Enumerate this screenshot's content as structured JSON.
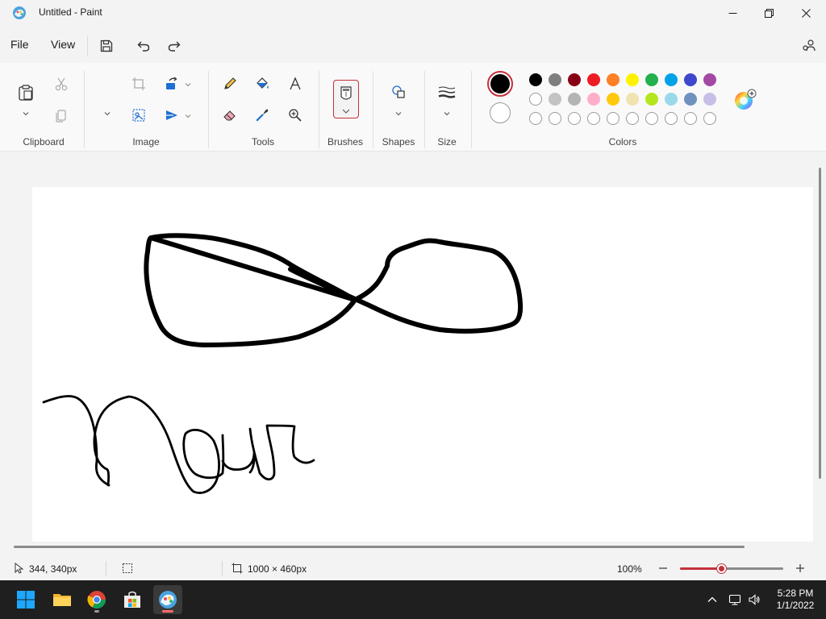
{
  "window": {
    "title": "Untitled - Paint"
  },
  "menu": {
    "file": "File",
    "view": "View"
  },
  "ribbon": {
    "groups": {
      "clipboard": "Clipboard",
      "image": "Image",
      "tools": "Tools",
      "brushes": "Brushes",
      "shapes": "Shapes",
      "size": "Size",
      "colors": "Colors"
    },
    "palette": {
      "row1": [
        "#000000",
        "#7f7f7f",
        "#880015",
        "#ed1c24",
        "#ff7f27",
        "#fff200",
        "#22b14c",
        "#00a2e8",
        "#3f48cc",
        "#a349a4"
      ],
      "row2": [
        "#ffffff",
        "#c3c3c3",
        "#b4b4b4",
        "#ffaec9",
        "#ffc90e",
        "#efe4b0",
        "#b5e61d",
        "#99d9ea",
        "#7092be",
        "#c8bfe7"
      ],
      "row3_empty_count": 10
    },
    "primary_color": "#000000",
    "secondary_color": "#ffffff"
  },
  "status": {
    "cursor_position": "344, 340px",
    "canvas_size": "1000 × 460px",
    "zoom_percent": "100%",
    "zoom_level": 0.4
  },
  "taskbar": {
    "time": "5:28 PM",
    "date": "1/1/2022"
  },
  "colors": {
    "accent": "#c4303a",
    "taskbar_bg": "#1f1f1f"
  }
}
